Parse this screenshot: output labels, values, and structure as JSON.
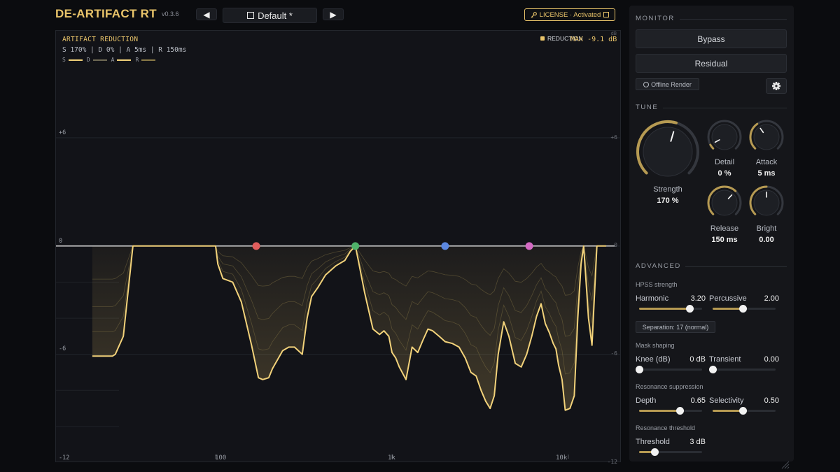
{
  "header": {
    "title": "DE-ARTIFACT RT",
    "version": "v0.3.6",
    "prev_icon": "◀",
    "next_icon": "▶",
    "preset_name": "Default *",
    "license_text": "LICENSE · Activated"
  },
  "display": {
    "title": "ARTIFACT REDUCTION",
    "params": "S 170% | D 0% | A 5ms | R 150ms",
    "legend": [
      {
        "label": "S",
        "color": "#f2d27a"
      },
      {
        "label": "D",
        "color": "#6f6a55"
      },
      {
        "label": "A",
        "color": "#f2d27a"
      },
      {
        "label": "R",
        "color": "#8a7a48"
      }
    ],
    "reduction_label": "REDUCTION",
    "reduction_max": "MAX -9.1 dB",
    "db_unit": "dB",
    "y_labels_left": [
      "+6",
      "0",
      "-6",
      "-12"
    ],
    "y_labels_right": [
      "+6",
      "0",
      "-6",
      "-12"
    ],
    "x_labels": [
      "100",
      "1k",
      "10k"
    ],
    "node_colors": [
      "#e05d5d",
      "#4fb26a",
      "#5b87e0",
      "#d46ac4"
    ],
    "curve_color": "#f2d27a"
  },
  "chart_data": {
    "type": "area",
    "x_scale": "log",
    "x_unit": "Hz",
    "y_unit": "dB",
    "ylim": [
      -12,
      6
    ],
    "x_ticks": [
      "100",
      "1k",
      "10k"
    ],
    "title": "ARTIFACT REDUCTION",
    "nodes_hz": [
      170,
      620,
      2000,
      6000
    ],
    "series": [
      {
        "name": "REDUCTION",
        "x": [
          20,
          26,
          27,
          30,
          34,
          100,
          103,
          110,
          125,
          140,
          160,
          175,
          185,
          200,
          210,
          240,
          260,
          280,
          310,
          330,
          350,
          380,
          420,
          480,
          540,
          580,
          620,
          650,
          700,
          780,
          850,
          900,
          960,
          1000,
          1050,
          1100,
          1200,
          1300,
          1400,
          1500,
          1600,
          1700,
          1850,
          2000,
          2200,
          2400,
          2600,
          2800,
          3000,
          3200,
          3400,
          3600,
          3800,
          4000,
          4300,
          4600,
          5000,
          5400,
          5800,
          6200,
          6600,
          7000,
          7400,
          7800,
          8200,
          8500,
          8800,
          9200,
          9600,
          10200,
          10800,
          11300,
          11800,
          12200,
          12600,
          13000,
          13600,
          14500,
          16000,
          20000
        ],
        "y": [
          -6.1,
          -6.1,
          -6.0,
          -5.0,
          0,
          0,
          -1.0,
          -1.8,
          -2.0,
          -3.1,
          -5.5,
          -7.3,
          -7.4,
          -7.3,
          -6.8,
          -5.8,
          -5.6,
          -5.6,
          -6.0,
          -4.0,
          -2.8,
          -2.3,
          -1.6,
          -1.1,
          -0.8,
          -0.3,
          0,
          -1.0,
          -2.6,
          -4.6,
          -4.9,
          -4.7,
          -5.0,
          -5.9,
          -6.2,
          -6.7,
          -7.4,
          -5.6,
          -5.9,
          -5.2,
          -4.6,
          -4.7,
          -5.0,
          -5.3,
          -5.4,
          -5.6,
          -6.2,
          -7.0,
          -7.2,
          -8.0,
          -8.6,
          -9.0,
          -8.3,
          -6.0,
          -4.2,
          -5.0,
          -6.5,
          -6.7,
          -6.0,
          -5.0,
          -3.9,
          -3.2,
          -4.3,
          -4.8,
          -5.4,
          -5.7,
          -6.6,
          -7.4,
          -9.1,
          -9.0,
          -8.3,
          -4.0,
          -1.0,
          0,
          -2.0,
          -4.0,
          -5.5,
          0,
          0,
          0
        ]
      }
    ]
  },
  "monitor": {
    "section": "MONITOR",
    "bypass_label": "Bypass",
    "residual_label": "Residual",
    "offline_label": "Offline Render",
    "settings_icon": "gear-icon"
  },
  "tune": {
    "section": "TUNE",
    "knobs": [
      {
        "id": "strength",
        "label": "Strength",
        "value": "170 %",
        "level": 0.56
      },
      {
        "id": "detail",
        "label": "Detail",
        "value": "0 %",
        "level": 0.06
      },
      {
        "id": "attack",
        "label": "Attack",
        "value": "5 ms",
        "level": 0.37
      },
      {
        "id": "release",
        "label": "Release",
        "value": "150 ms",
        "level": 0.66
      },
      {
        "id": "bright",
        "label": "Bright",
        "value": "0.00",
        "level": 0.5
      }
    ]
  },
  "advanced": {
    "section": "ADVANCED",
    "hpss_label": "HPSS strength",
    "harmonic": {
      "label": "Harmonic",
      "value": "3.20",
      "level": 0.8
    },
    "percussive": {
      "label": "Percussive",
      "value": "2.00",
      "level": 0.48
    },
    "separation_label": "Separation: 17 (normal)",
    "mask_label": "Mask shaping",
    "knee": {
      "label": "Knee (dB)",
      "value": "0 dB",
      "level": 0.0
    },
    "transient": {
      "label": "Transient",
      "value": "0.00",
      "level": 0.0
    },
    "res_supp_label": "Resonance suppression",
    "depth": {
      "label": "Depth",
      "value": "0.65",
      "level": 0.64
    },
    "selectivity": {
      "label": "Selectivity",
      "value": "0.50",
      "level": 0.48
    },
    "res_thresh_label": "Resonance threshold",
    "threshold": {
      "label": "Threshold",
      "value": "3 dB",
      "level": 0.24
    }
  }
}
